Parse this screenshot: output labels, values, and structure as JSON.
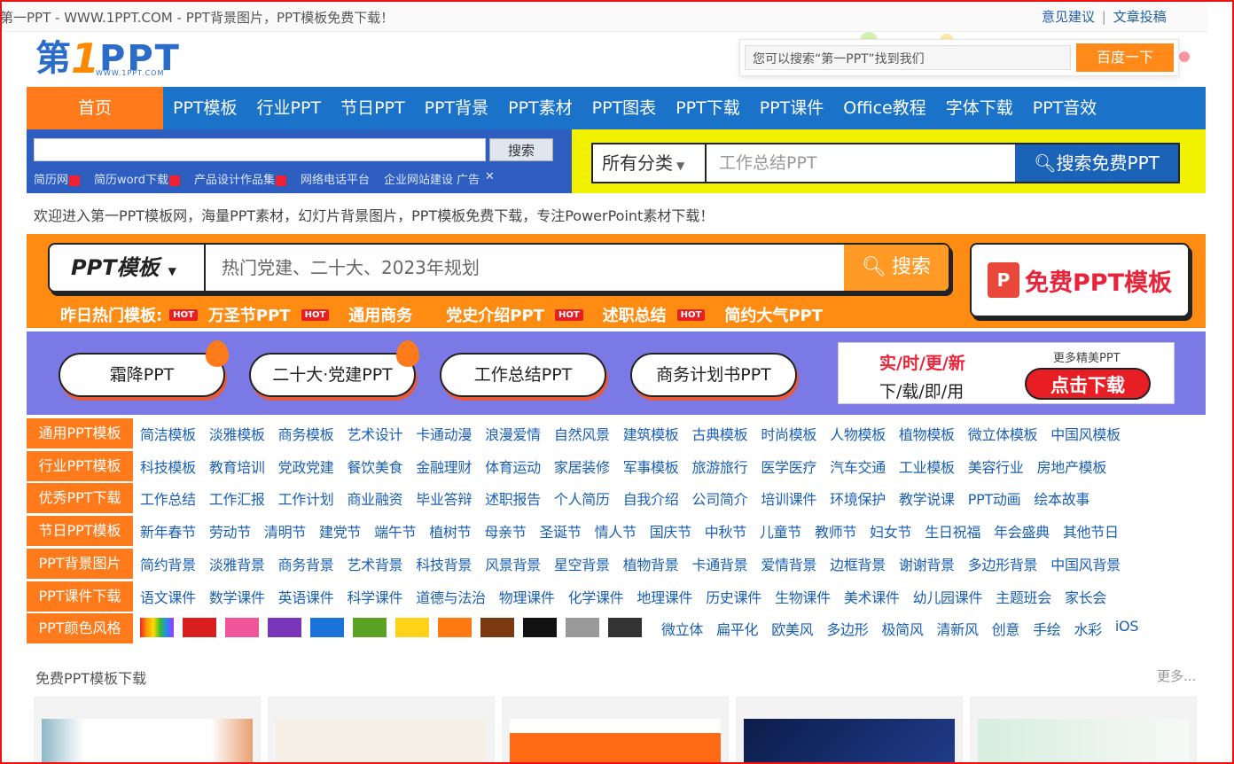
{
  "header": {
    "site_title": "第一PPT - WWW.1PPT.COM - PPT背景图片，PPT模板免费下载！",
    "feedback_link": "意见建议",
    "separator": "|",
    "submit_link": "文章投稿",
    "logo": {
      "part1": "第",
      "part2": "1",
      "part3": "PPT",
      "sub": "WWW.1PPT.COM"
    },
    "search_placeholder": "您可以搜索“第一PPT”找到我们",
    "search_button": "百度一下"
  },
  "nav": {
    "home": "首页",
    "items": [
      "PPT模板",
      "行业PPT",
      "节日PPT",
      "PPT背景",
      "PPT素材",
      "PPT图表",
      "PPT下载",
      "PPT课件",
      "Office教程",
      "字体下载",
      "PPT音效"
    ]
  },
  "ad_search": {
    "button": "搜索",
    "links": [
      "简历网",
      "简历word下载",
      "产品设计作品集",
      "网络电话平台",
      "企业网站建设"
    ],
    "ad_mark": "广告"
  },
  "category_search": {
    "select": "所有分类",
    "placeholder": "工作总结PPT",
    "button": "搜索免费PPT"
  },
  "welcome_text": "欢迎进入第一PPT模板网，海量PPT素材，幻灯片背景图片，PPT模板免费下载，专注PowerPoint素材下载！",
  "orange_search": {
    "select": "PPT模板",
    "placeholder": "热门党建、二十大、2023年规划",
    "button": "搜索",
    "free_label": "免费PPT模板",
    "free_icon": "P",
    "hot_prefix": "昨日热门模板:",
    "hot_items": [
      {
        "label": "万圣节PPT",
        "hot": true
      },
      {
        "label": "通用商务",
        "hot": false
      },
      {
        "label": "党史介绍PPT",
        "hot": true
      },
      {
        "label": "述职总结",
        "hot": true
      },
      {
        "label": "简约大气PPT",
        "hot": false
      }
    ],
    "hot_badge": "HOT"
  },
  "pills": [
    "霜降PPT",
    "二十大·党建PPT",
    "工作总结PPT",
    "商务计划书PPT"
  ],
  "realtime": {
    "line1": "实/时/更/新",
    "line2": "下/载/即/用",
    "more": "更多精美PPT",
    "button": "点击下载"
  },
  "categories": [
    {
      "label": "通用PPT模板",
      "links": [
        "简洁模板",
        "淡雅模板",
        "商务模板",
        "艺术设计",
        "卡通动漫",
        "浪漫爱情",
        "自然风景",
        "建筑模板",
        "古典模板",
        "时尚模板",
        "人物模板",
        "植物模板",
        "微立体模板",
        "中国风模板"
      ]
    },
    {
      "label": "行业PPT模板",
      "links": [
        "科技模板",
        "教育培训",
        "党政党建",
        "餐饮美食",
        "金融理财",
        "体育运动",
        "家居装修",
        "军事模板",
        "旅游旅行",
        "医学医疗",
        "汽车交通",
        "工业模板",
        "美容行业",
        "房地产模板"
      ]
    },
    {
      "label": "优秀PPT下载",
      "links": [
        "工作总结",
        "工作汇报",
        "工作计划",
        "商业融资",
        "毕业答辩",
        "述职报告",
        "个人简历",
        "自我介绍",
        "公司简介",
        "培训课件",
        "环境保护",
        "教学说课",
        "PPT动画",
        "绘本故事"
      ]
    },
    {
      "label": "节日PPT模板",
      "links": [
        "新年春节",
        "劳动节",
        "清明节",
        "建党节",
        "端午节",
        "植树节",
        "母亲节",
        "圣诞节",
        "情人节",
        "国庆节",
        "中秋节",
        "儿童节",
        "教师节",
        "妇女节",
        "生日祝福",
        "年会盛典",
        "其他节日"
      ]
    },
    {
      "label": "PPT背景图片",
      "links": [
        "简约背景",
        "淡雅背景",
        "商务背景",
        "艺术背景",
        "科技背景",
        "风景背景",
        "星空背景",
        "植物背景",
        "卡通背景",
        "爱情背景",
        "边框背景",
        "谢谢背景",
        "多边形背景",
        "中国风背景"
      ]
    },
    {
      "label": "PPT课件下载",
      "links": [
        "语文课件",
        "数学课件",
        "英语课件",
        "科学课件",
        "道德与法治",
        "物理课件",
        "化学课件",
        "地理课件",
        "历史课件",
        "生物课件",
        "美术课件",
        "幼儿园课件",
        "主题班会",
        "家长会"
      ]
    },
    {
      "label": "PPT颜色风格",
      "colors": [
        "rainbow",
        "#d81e1e",
        "#f0559a",
        "#7a36b8",
        "#1a73d8",
        "#5aa324",
        "#ffd21a",
        "#ff7a10",
        "#7a3a10",
        "#111111",
        "#9a9a9a",
        "#333333"
      ],
      "links": [
        "微立体",
        "扁平化",
        "欧美风",
        "多边形",
        "极简风",
        "清新风",
        "创意",
        "手绘",
        "水彩",
        "iOS"
      ]
    }
  ],
  "free_section": {
    "title": "免费PPT模板下载",
    "more": "更多..."
  },
  "colors": {
    "orange": "#ff8c12",
    "blue": "#1a73c8",
    "purple": "#7a79e6",
    "red": "#e8233a",
    "yellow": "#f2f200"
  }
}
